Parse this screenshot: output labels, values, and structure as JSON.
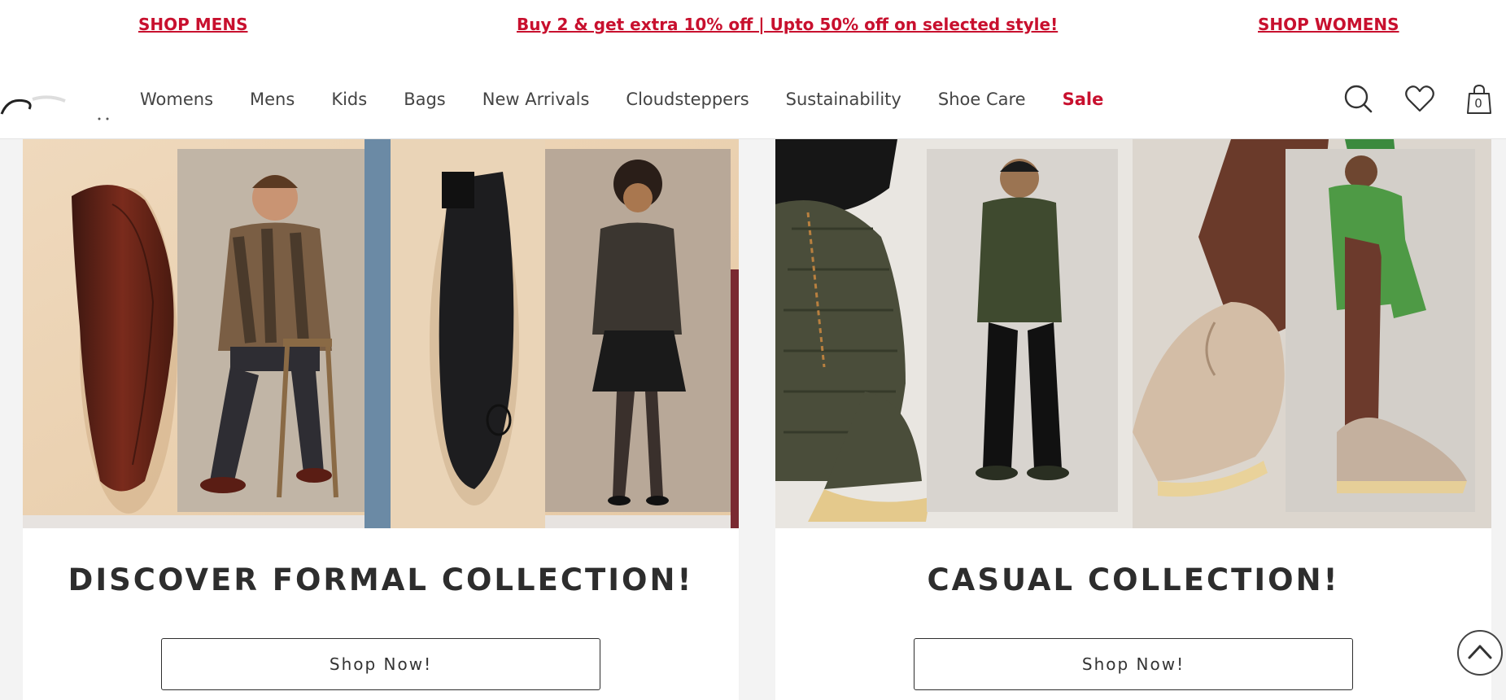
{
  "promo": {
    "shop_mens": "SHOP MENS",
    "offer": "Buy 2 & get extra 10% off  |  Upto 50% off on selected style!",
    "shop_womens": "SHOP WOMENS"
  },
  "nav": {
    "items": [
      "Womens",
      "Mens",
      "Kids",
      "Bags",
      "New Arrivals",
      "Cloudsteppers",
      "Sustainability",
      "Shoe Care",
      "Sale"
    ]
  },
  "header_icons": {
    "search": "search-icon",
    "wishlist": "heart-icon",
    "bag": "shopping-bag-icon",
    "bag_count": "0"
  },
  "cards": [
    {
      "title": "DISCOVER FORMAL COLLECTION!",
      "button": "Shop Now!"
    },
    {
      "title": "CASUAL COLLECTION!",
      "button": "Shop Now!"
    }
  ],
  "colors": {
    "accent": "#c8102e",
    "text": "#2d2d2d",
    "page_bg": "#f3f3f3"
  }
}
